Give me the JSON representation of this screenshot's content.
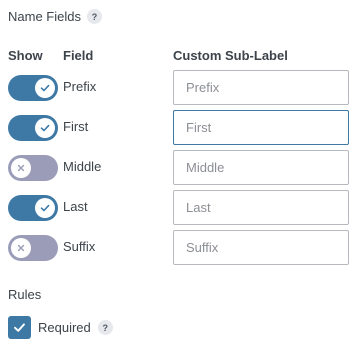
{
  "section": {
    "title": "Name Fields",
    "help_glyph": "?"
  },
  "columns": {
    "show": "Show",
    "field": "Field",
    "custom_sub_label": "Custom Sub-Label"
  },
  "fields": [
    {
      "label": "Prefix",
      "enabled": true,
      "placeholder": "Prefix",
      "focused": false
    },
    {
      "label": "First",
      "enabled": true,
      "placeholder": "First",
      "focused": true
    },
    {
      "label": "Middle",
      "enabled": false,
      "placeholder": "Middle",
      "focused": false
    },
    {
      "label": "Last",
      "enabled": true,
      "placeholder": "Last",
      "focused": false
    },
    {
      "label": "Suffix",
      "enabled": false,
      "placeholder": "Suffix",
      "focused": false
    }
  ],
  "rules": {
    "title": "Rules",
    "required_label": "Required",
    "required_checked": true,
    "help_glyph": "?"
  },
  "colors": {
    "toggle_on": "#3e79a6",
    "toggle_off": "#9b9db8",
    "checkbox": "#3e79a6",
    "focus_border": "#3e79a6"
  },
  "icons": {
    "toggle_on": "check-icon",
    "toggle_off": "x-icon",
    "checkbox": "check-icon",
    "help": "question-icon"
  }
}
